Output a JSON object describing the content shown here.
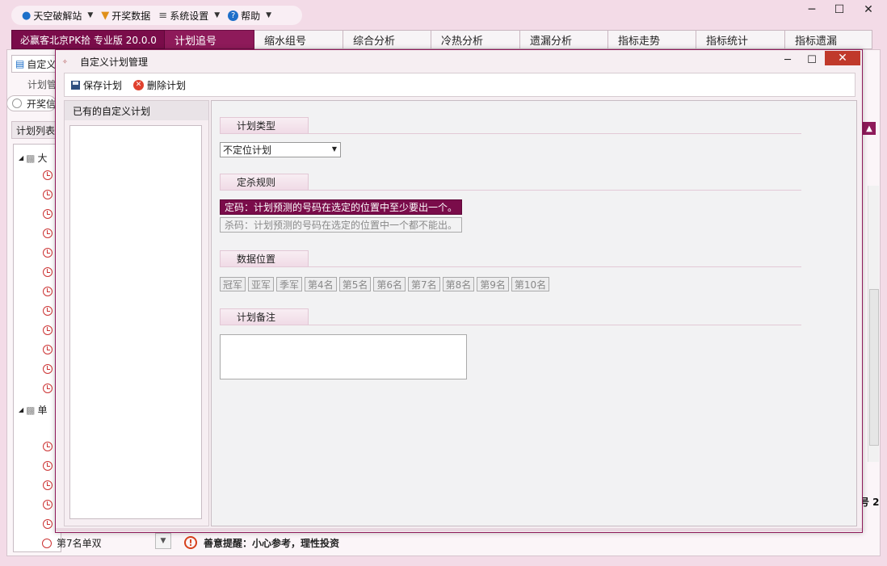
{
  "menubar": {
    "items": [
      {
        "label": "天空破解站",
        "icon": "user-icon",
        "color": "#1e6fc9"
      },
      {
        "label": "开奖数据",
        "icon": "trophy-icon",
        "color": "#e0901a"
      },
      {
        "label": "系统设置",
        "icon": "sliders-icon",
        "color": "#555555"
      },
      {
        "label": "帮助",
        "icon": "help-icon",
        "color": "#1e6fc9"
      }
    ]
  },
  "tabs": {
    "brand": "必赢客北京PK拾 专业版 20.0.0",
    "items": [
      "计划追号",
      "缩水组号",
      "综合分析",
      "冷热分析",
      "遗漏分析",
      "指标走势",
      "指标统计",
      "指标遗漏"
    ],
    "active": "计划追号"
  },
  "background": {
    "toolbar_label": "自定义",
    "plan_manage_label": "计划管",
    "open_label": "开奖信",
    "plan_list_label": "计划列表",
    "tree_group1": "大",
    "tree_group2": "单",
    "tree_last_item": "第7名单双",
    "reminder": "善意提醒：小心参考，理性投资",
    "page_indicator": "号 2"
  },
  "dialog": {
    "title": "自定义计划管理",
    "save_label": "保存计划",
    "delete_label": "删除计划",
    "left_header": "已有的自定义计划",
    "plan_type_label": "计划类型",
    "plan_type_value": "不定位计划",
    "rule_label": "定杀规则",
    "rule_dingma": "定码：计划预测的号码在选定的位置中至少要出一个。",
    "rule_shama": "杀码：计划预测的号码在选定的位置中一个都不能出。",
    "position_label": "数据位置",
    "positions": [
      "冠军",
      "亚军",
      "季军",
      "第4名",
      "第5名",
      "第6名",
      "第7名",
      "第8名",
      "第9名",
      "第10名"
    ],
    "note_label": "计划备注"
  },
  "colors": {
    "brand": "#7a0c4a",
    "active_tab": "#8e1a5a",
    "close_button": "#c0392b"
  }
}
